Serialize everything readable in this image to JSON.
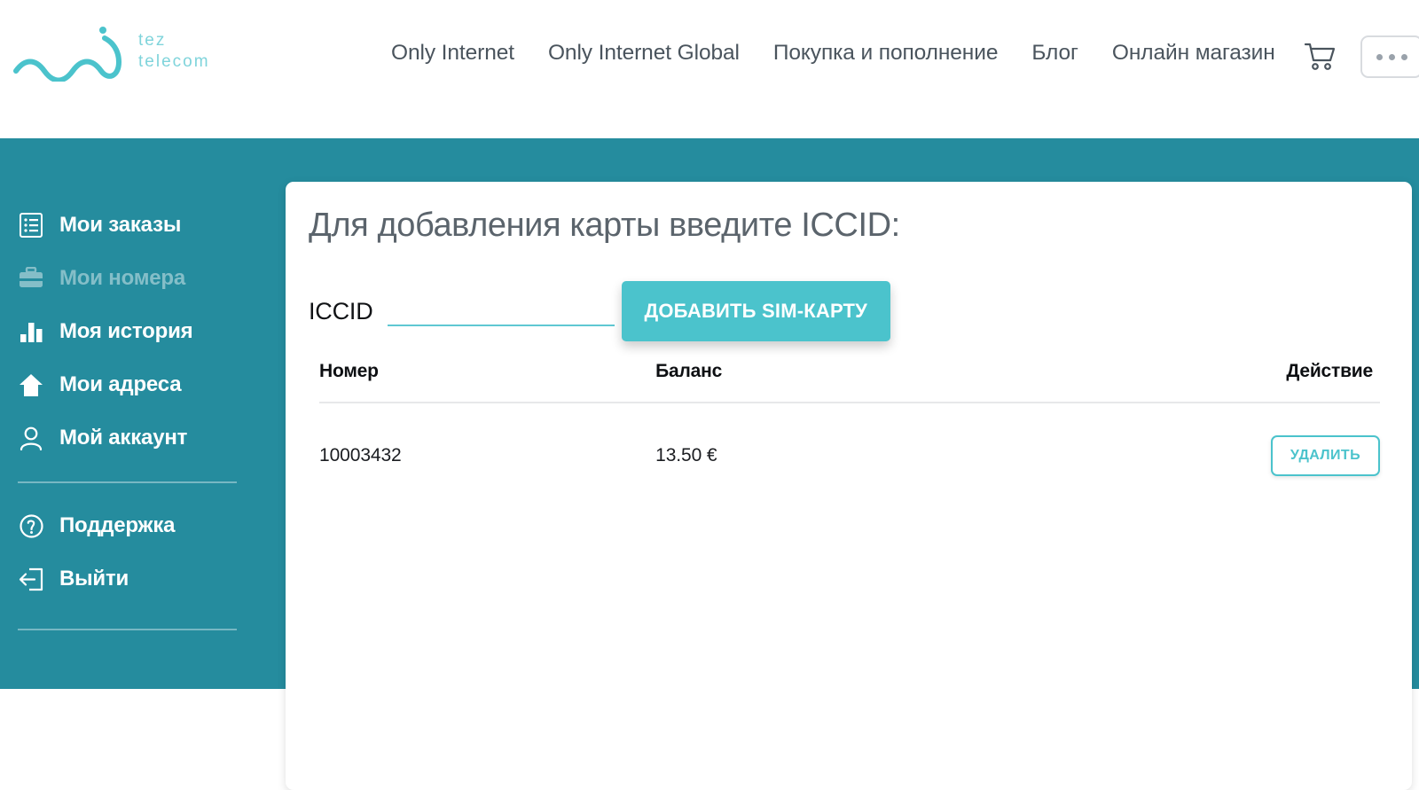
{
  "brand": {
    "name_line1": "tez",
    "name_line2": "telecom",
    "color": "#4bc3cc"
  },
  "header": {
    "nav": [
      {
        "label": "Only Internet"
      },
      {
        "label": "Only Internet Global"
      },
      {
        "label": "Покупка и пополнение"
      },
      {
        "label": "Блог"
      },
      {
        "label": "Онлайн магазин"
      }
    ],
    "cart_icon": "shopping-cart-icon",
    "more_icon": "ellipsis-icon"
  },
  "sidebar": {
    "items": [
      {
        "label": "Мои заказы",
        "icon": "list-document-icon",
        "active": false
      },
      {
        "label": "Мои номера",
        "icon": "briefcase-icon",
        "active": true
      },
      {
        "label": "Моя история",
        "icon": "bar-chart-icon",
        "active": false
      },
      {
        "label": "Мои адреса",
        "icon": "home-icon",
        "active": false
      },
      {
        "label": "Мой аккаунт",
        "icon": "user-icon",
        "active": false
      }
    ],
    "secondary": [
      {
        "label": "Поддержка",
        "icon": "question-circle-icon"
      },
      {
        "label": "Выйти",
        "icon": "logout-icon"
      }
    ]
  },
  "main": {
    "title": "Для добавления карты введите ICCID:",
    "form": {
      "label": "ICCID",
      "value": "",
      "placeholder": "",
      "submit_label": "ДОБАВИТЬ SIM-КАРТУ"
    },
    "table": {
      "columns": [
        "Номер",
        "Баланс",
        "Действие"
      ],
      "rows": [
        {
          "number": "10003432",
          "balance": "13.50 €",
          "action_label": "УДАЛИТЬ"
        }
      ]
    }
  },
  "colors": {
    "sidebar_bg": "#258c9e",
    "accent": "#4bc3cc",
    "nav_text": "#4a545d",
    "title_text": "#5b646c"
  }
}
